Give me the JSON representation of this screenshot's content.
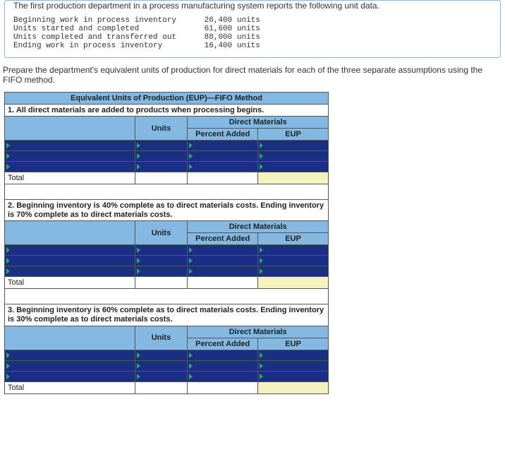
{
  "problem": {
    "intro": "The first production department in a process manufacturing system reports the following unit data.",
    "lines": [
      {
        "label": "Beginning work in process inventory",
        "value": "26,400 units"
      },
      {
        "label": "Units started and completed",
        "value": "61,600 units"
      },
      {
        "label": "Units completed and transferred out",
        "value": "88,000 units"
      },
      {
        "label": "Ending work in process inventory",
        "value": "16,400 units"
      }
    ]
  },
  "instructions": "Prepare the department's equivalent units of production for direct materials for each of the three separate assumptions using the FIFO method.",
  "table": {
    "title": "Equivalent Units of Production (EUP)—FIFO Method",
    "col_units": "Units",
    "col_dm": "Direct Materials",
    "col_pct": "Percent Added",
    "col_eup": "EUP",
    "total_label": "Total",
    "sections": [
      {
        "heading": "1. All direct materials are added to products when processing begins."
      },
      {
        "heading": "2. Beginning inventory is 40% complete as to direct materials costs. Ending inventory is 70% complete as to direct materials costs."
      },
      {
        "heading": "3. Beginning inventory is 60% complete as to direct materials costs. Ending inventory is 30% complete as to direct materials costs."
      }
    ]
  }
}
